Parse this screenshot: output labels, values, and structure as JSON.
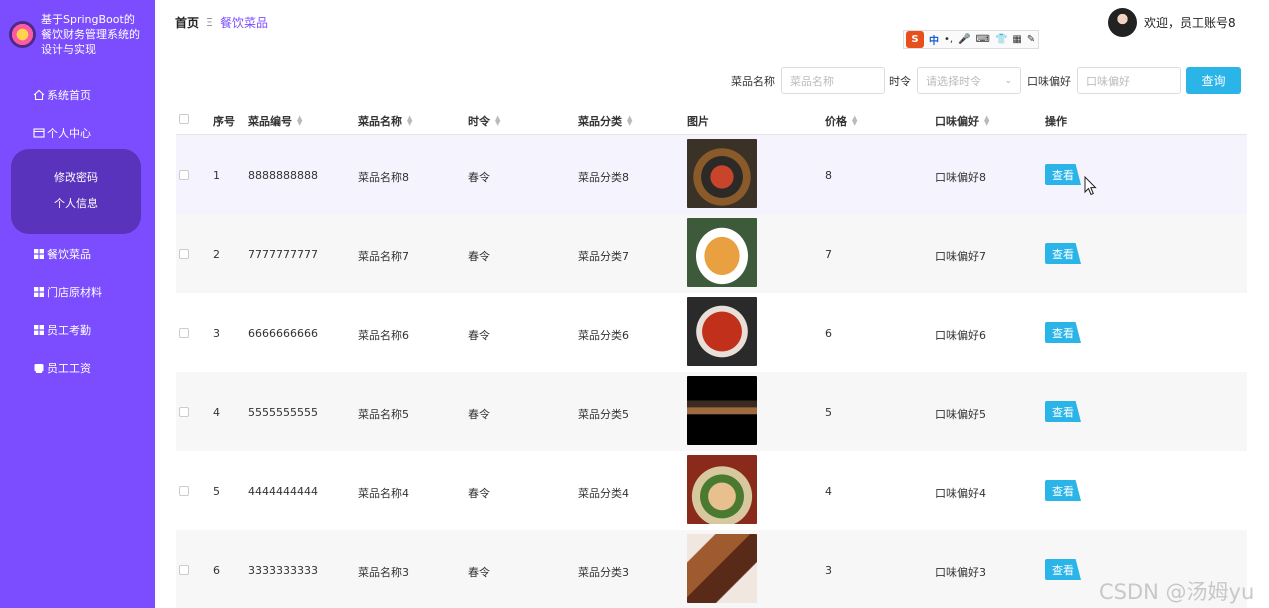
{
  "sidebar": {
    "title": "基于SpringBoot的餐饮财务管理系统的设计与实现",
    "items": [
      {
        "label": "系统首页",
        "icon": "home-icon"
      },
      {
        "label": "个人中心",
        "icon": "id-card-icon"
      },
      {
        "label": "餐饮菜品",
        "icon": "grid-icon"
      },
      {
        "label": "门店原材料",
        "icon": "grid-icon"
      },
      {
        "label": "员工考勤",
        "icon": "grid-icon"
      },
      {
        "label": "员工工资",
        "icon": "wallet-icon"
      }
    ],
    "submenu": [
      "修改密码",
      "个人信息"
    ]
  },
  "header": {
    "breadcrumb_home": "首页",
    "breadcrumb_sep": "Ξ",
    "breadcrumb_current": "餐饮菜品",
    "welcome": "欢迎，员工账号8"
  },
  "search": {
    "name_label": "菜品名称",
    "name_placeholder": "菜品名称",
    "season_label": "时令",
    "season_placeholder": "请选择时令",
    "taste_label": "口味偏好",
    "taste_placeholder": "口味偏好",
    "query_label": "查询"
  },
  "table": {
    "headers": [
      "序号",
      "菜品编号",
      "菜品名称",
      "时令",
      "菜品分类",
      "图片",
      "价格",
      "口味偏好",
      "操作"
    ],
    "rows": [
      {
        "index": "1",
        "code": "8888888888",
        "name": "菜品名称8",
        "season": "春令",
        "category": "菜品分类8",
        "price": "8",
        "taste": "口味偏好8",
        "action": "查看"
      },
      {
        "index": "2",
        "code": "7777777777",
        "name": "菜品名称7",
        "season": "春令",
        "category": "菜品分类7",
        "price": "7",
        "taste": "口味偏好7",
        "action": "查看"
      },
      {
        "index": "3",
        "code": "6666666666",
        "name": "菜品名称6",
        "season": "春令",
        "category": "菜品分类6",
        "price": "6",
        "taste": "口味偏好6",
        "action": "查看"
      },
      {
        "index": "4",
        "code": "5555555555",
        "name": "菜品名称5",
        "season": "春令",
        "category": "菜品分类5",
        "price": "5",
        "taste": "口味偏好5",
        "action": "查看"
      },
      {
        "index": "5",
        "code": "4444444444",
        "name": "菜品名称4",
        "season": "春令",
        "category": "菜品分类4",
        "price": "4",
        "taste": "口味偏好4",
        "action": "查看"
      },
      {
        "index": "6",
        "code": "3333333333",
        "name": "菜品名称3",
        "season": "春令",
        "category": "菜品分类3",
        "price": "3",
        "taste": "口味偏好3",
        "action": "查看"
      }
    ]
  },
  "ime": {
    "zh": "中"
  },
  "watermark": "CSDN @汤姆yu",
  "colors": {
    "sidebar": "#7b4dff",
    "submenu": "#5a33bd",
    "accent": "#2bb4e8"
  }
}
